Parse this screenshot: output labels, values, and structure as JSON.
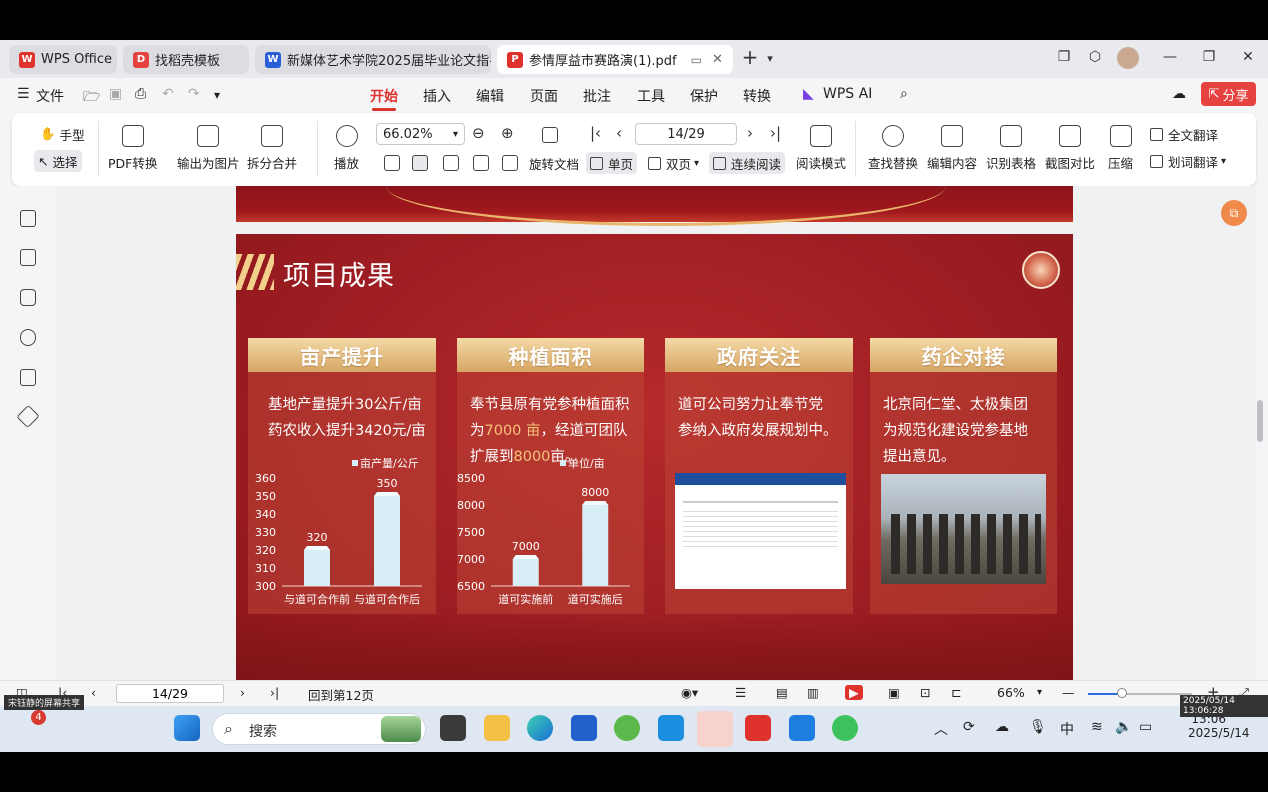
{
  "tabs": [
    {
      "label": "WPS Office",
      "icon": "wps-logo-icon",
      "color": "#e0322d"
    },
    {
      "label": "找稻壳模板",
      "icon": "docer-icon",
      "color": "#e64340"
    },
    {
      "label": "新媒体艺术学院2025届毕业论文指导",
      "icon": "word-doc-icon",
      "color": "#2b5fd9"
    },
    {
      "label": "参情厚益市赛路演(1).pdf",
      "icon": "pdf-icon",
      "color": "#e0322d"
    }
  ],
  "menu": {
    "file": "文件",
    "items": [
      "开始",
      "插入",
      "编辑",
      "页面",
      "批注",
      "工具",
      "保护",
      "转换"
    ],
    "wps_ai": "WPS AI",
    "share": "分享"
  },
  "toolbar": {
    "hand": "手型",
    "select": "选择",
    "pdf_convert": "PDF转换",
    "export_image": "输出为图片",
    "split_merge": "拆分合并",
    "play": "播放",
    "zoom_value": "66.02%",
    "page_value": "14/29",
    "rotate": "旋转文档",
    "single": "单页",
    "double": "双页",
    "continuous": "连续阅读",
    "read_mode": "阅读模式",
    "find_replace": "查找替换",
    "edit_content": "编辑内容",
    "recognize_table": "识别表格",
    "screenshot_compare": "截图对比",
    "compress": "压缩",
    "full_translate": "全文翻译",
    "word_translate": "划词翻译"
  },
  "slide": {
    "title": "项目成果",
    "cards": [
      {
        "heading": "亩产提升",
        "lines": [
          "基地产量提升30公斤/亩",
          "药农收入提升3420元/亩"
        ]
      },
      {
        "heading": "种植面积",
        "lines_html": [
          "奉节县原有党参种植面积",
          "为",
          "7000 亩",
          "，经道可团队",
          "扩展到",
          "8000",
          "亩。"
        ]
      },
      {
        "heading": "政府关注",
        "lines": [
          "道可公司努力让奉节党",
          "参纳入政府发展规划中。"
        ]
      },
      {
        "heading": "药企对接",
        "lines": [
          "北京同仁堂、太极集团",
          "为规范化建设党参基地",
          "提出意见。"
        ]
      }
    ]
  },
  "chart_data": [
    {
      "type": "bar",
      "categories": [
        "与道可合作前",
        "与道可合作后"
      ],
      "values": [
        320,
        350
      ],
      "legend": "亩产量/公斤",
      "yticks": [
        300,
        310,
        320,
        330,
        340,
        350,
        360
      ],
      "ylim": [
        300,
        360
      ]
    },
    {
      "type": "bar",
      "categories": [
        "道可实施前",
        "道可实施后"
      ],
      "values": [
        7000,
        8000
      ],
      "legend": "单位/亩",
      "yticks": [
        6500,
        7000,
        7500,
        8000,
        8500
      ],
      "ylim": [
        6500,
        8500
      ]
    }
  ],
  "status": {
    "page_value": "14/29",
    "back_to": "回到第12页",
    "zoom": "66%",
    "zoom_fraction": 0.33
  },
  "taskbar": {
    "search": "搜索",
    "ime": "中",
    "time": "13:06",
    "date": "2025/5/14",
    "tooltip": "2025/05/14 13:06:28",
    "notif_count": "4",
    "notif_text": "宋钰静的屏幕共享"
  },
  "colors": {
    "accent": "#e0322d",
    "slide_bg": "#9d1d22",
    "card_head": "#d6a663",
    "bar": "#d8eef7"
  }
}
